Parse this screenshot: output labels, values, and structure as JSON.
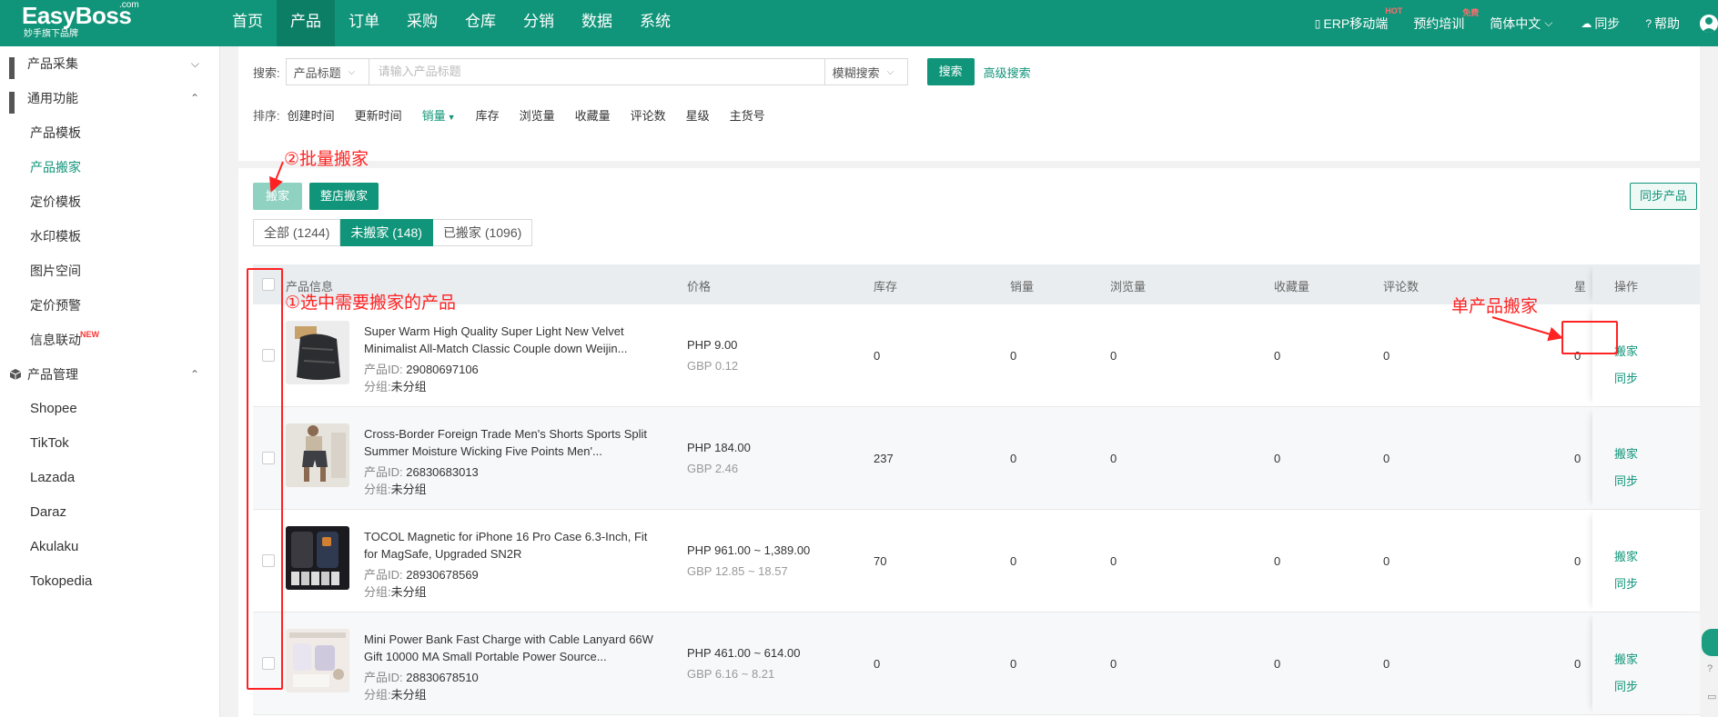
{
  "brand": {
    "name": "EasyBoss",
    "com": ".com",
    "tagline": "妙手旗下品牌"
  },
  "nav": [
    {
      "label": "首页",
      "active": false
    },
    {
      "label": "产品",
      "active": true
    },
    {
      "label": "订单",
      "active": false
    },
    {
      "label": "采购",
      "active": false
    },
    {
      "label": "仓库",
      "active": false
    },
    {
      "label": "分销",
      "active": false
    },
    {
      "label": "数据",
      "active": false
    },
    {
      "label": "系统",
      "active": false
    }
  ],
  "tools": {
    "erp": "ERP移动端",
    "erp_badge": "HOT",
    "training": "预约培训",
    "training_badge": "免费",
    "language": "简体中文",
    "sync": "同步",
    "help": "帮助"
  },
  "sidebar": {
    "group1": "产品采集",
    "group2": "通用功能",
    "items": [
      "产品模板",
      "产品搬家",
      "定价模板",
      "水印模板",
      "图片空间",
      "定价预警",
      "信息联动"
    ],
    "new_badge": "NEW",
    "group3": "产品管理",
    "shops": [
      "Shopee",
      "TikTok",
      "Lazada",
      "Daraz",
      "Akulaku",
      "Tokopedia"
    ]
  },
  "search": {
    "label": "搜索:",
    "field": "产品标题",
    "placeholder": "请输入产品标题",
    "mode": "模糊搜索",
    "button": "搜索",
    "advanced": "高级搜索"
  },
  "sort": {
    "label": "排序:",
    "options": [
      "创建时间",
      "更新时间",
      "销量",
      "库存",
      "浏览量",
      "收藏量",
      "评论数",
      "星级",
      "主货号"
    ]
  },
  "actions": {
    "move": "搬家",
    "move_store": "整店搬家",
    "sync_products": "同步产品"
  },
  "tabs": [
    "全部 (1244)",
    "未搬家 (148)",
    "已搬家 (1096)"
  ],
  "columns": {
    "info": "产品信息",
    "price": "价格",
    "stock": "库存",
    "sales": "销量",
    "views": "浏览量",
    "favs": "收藏量",
    "reviews": "评论数",
    "star": "星",
    "ops": "操作"
  },
  "labels": {
    "id": "产品ID:",
    "group": "分组:",
    "op_move": "搬家",
    "op_sync": "同步"
  },
  "rows": [
    {
      "title": "Super Warm High Quality Super Light New Velvet Minimalist All-Match Classic Couple down Weijin...",
      "id": "29080697106",
      "group": "未分组",
      "price": "PHP 9.00",
      "price_gbp": "GBP 0.12",
      "stock": "0",
      "sales": "0",
      "views": "0",
      "favs": "0",
      "reviews": "0",
      "star": "0"
    },
    {
      "title": "Cross-Border Foreign Trade Men's Shorts Sports Split Summer Moisture Wicking Five Points Men'...",
      "id": "26830683013",
      "group": "未分组",
      "price": "PHP 184.00",
      "price_gbp": "GBP 2.46",
      "stock": "237",
      "sales": "0",
      "views": "0",
      "favs": "0",
      "reviews": "0",
      "star": "0"
    },
    {
      "title": "TOCOL Magnetic for iPhone 16 Pro Case 6.3-Inch, Fit for MagSafe, Upgraded  SN2R",
      "id": "28930678569",
      "group": "未分组",
      "price": "PHP 961.00 ~ 1,389.00",
      "price_gbp": "GBP 12.85 ~ 18.57",
      "stock": "70",
      "sales": "0",
      "views": "0",
      "favs": "0",
      "reviews": "0",
      "star": "0"
    },
    {
      "title": "Mini Power Bank Fast Charge with Cable Lanyard 66W Gift 10000 MA Small Portable Power Source...",
      "id": "28830678510",
      "group": "未分组",
      "price": "PHP 461.00 ~ 614.00",
      "price_gbp": "GBP 6.16 ~ 8.21",
      "stock": "0",
      "sales": "0",
      "views": "0",
      "favs": "0",
      "reviews": "0",
      "star": "0"
    }
  ],
  "annotations": {
    "batch": "②批量搬家",
    "select": "①选中需要搬家的产品",
    "single": "单产品搬家"
  }
}
